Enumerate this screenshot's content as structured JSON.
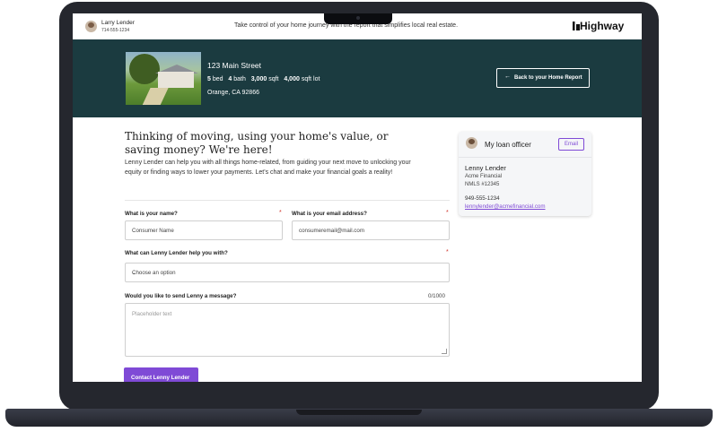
{
  "topbar": {
    "agent_name": "Larry Lender",
    "agent_phone": "714-555-1234",
    "tagline": "Take control of your home journey with the report that simplifies local real estate.",
    "brand": "Highway"
  },
  "property": {
    "address": "123 Main Street",
    "beds": "5",
    "beds_unit": "bed",
    "baths": "4",
    "baths_unit": "bath",
    "sqft": "3,000",
    "sqft_unit": "sqft",
    "lot": "4,000",
    "lot_unit": "sqft lot",
    "city": "Orange, CA 92866",
    "back_button": "Back to your Home Report"
  },
  "form": {
    "headline": "Thinking of moving, using your home's value, or saving money? We're here!",
    "intro": "Lenny Lender can help you with all things home-related, from guiding your next move to unlocking your equity or finding ways to lower your payments. Let's chat and make your financial goals a reality!",
    "name_label": "What is your name?",
    "name_value": "Consumer Name",
    "email_label": "What is your email address?",
    "email_value": "consumeremail@mail.com",
    "help_label": "What can Lenny Lender help you with?",
    "help_value": "Choose an option",
    "message_label": "Would you like to send Lenny a message?",
    "message_counter": "0/1000",
    "message_placeholder": "Placeholder text",
    "required_mark": "*",
    "submit_label": "Contact Lenny Lender"
  },
  "loan_officer": {
    "title": "My loan officer",
    "email_button": "Email",
    "name": "Lenny Lender",
    "company": "Acme Financial",
    "nmls": "NMLS #12345",
    "phone": "949-555-1234",
    "email": "lennylender@acmefinancial.com"
  },
  "colors": {
    "hero_bg": "#1b3b40",
    "accent": "#7f4ad6",
    "required": "#d0342c"
  }
}
